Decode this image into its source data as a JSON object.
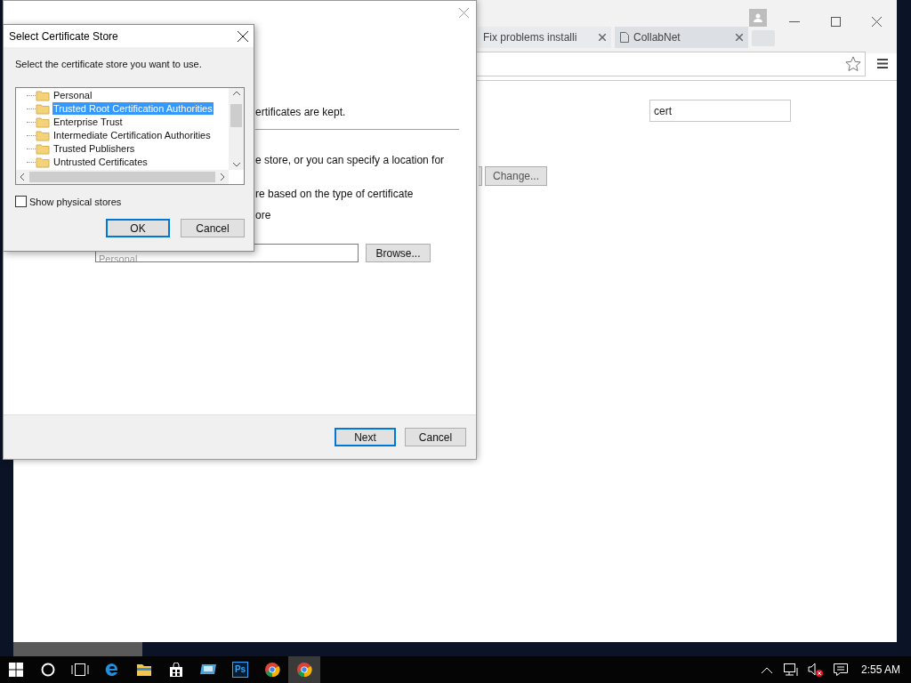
{
  "browser": {
    "tabs": [
      {
        "title": "Fix problems installi",
        "selected": false
      },
      {
        "title": "CollabNet",
        "selected": true
      }
    ],
    "search_field": {
      "value": "cert"
    },
    "change_button": "Change..."
  },
  "wizard": {
    "fragments": [
      "ertificates are kept.",
      "e store, or you can specify a location for",
      "re based on the type of certificate",
      "ore"
    ],
    "store_field": {
      "value": "Personal"
    },
    "browse_button": "Browse...",
    "buttons": [
      {
        "label": "Next",
        "default": true
      },
      {
        "label": "Cancel",
        "default": false
      }
    ]
  },
  "dialog": {
    "title": "Select Certificate Store",
    "prompt": "Select the certificate store you want to use.",
    "stores": [
      {
        "name": "Personal",
        "selected": false
      },
      {
        "name": "Trusted Root Certification Authorities",
        "selected": true
      },
      {
        "name": "Enterprise Trust",
        "selected": false
      },
      {
        "name": "Intermediate Certification Authorities",
        "selected": false
      },
      {
        "name": "Trusted Publishers",
        "selected": false
      },
      {
        "name": "Untrusted Certificates",
        "selected": false
      }
    ],
    "show_physical": {
      "label": "Show physical stores",
      "checked": false
    },
    "buttons": [
      {
        "label": "OK",
        "default": true
      },
      {
        "label": "Cancel",
        "default": false
      }
    ]
  },
  "taskbar": {
    "apps": [
      {
        "kind": "edge",
        "active": false
      },
      {
        "kind": "folder",
        "active": false
      },
      {
        "kind": "store",
        "active": false
      },
      {
        "kind": "monitor",
        "active": false
      },
      {
        "kind": "ps",
        "label": "Ps",
        "active": false
      },
      {
        "kind": "chrome",
        "active": false
      },
      {
        "kind": "chrome",
        "active": true
      }
    ],
    "clock": "2:55 AM"
  }
}
